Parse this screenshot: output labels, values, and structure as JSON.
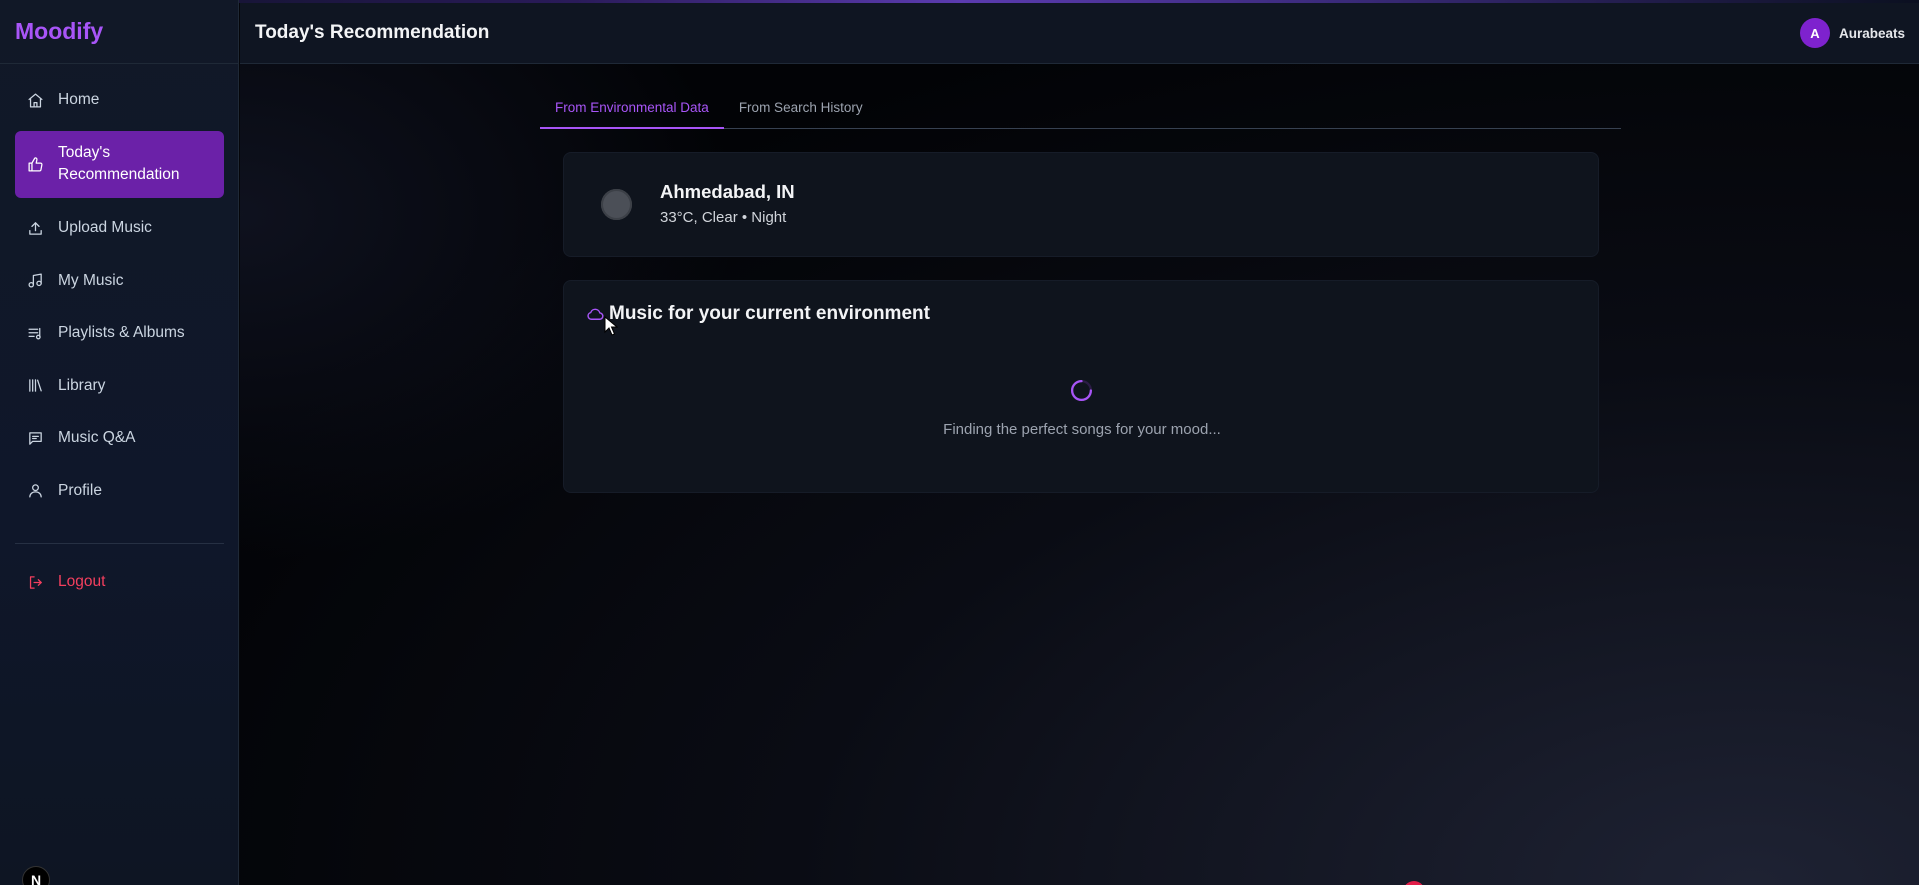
{
  "app": {
    "brand": "Moodify"
  },
  "sidebar": {
    "items": [
      {
        "label": "Home",
        "icon": "home-icon"
      },
      {
        "label": "Today's Recommendation",
        "icon": "thumbs-up-icon",
        "active": true
      },
      {
        "label": "Upload Music",
        "icon": "upload-icon"
      },
      {
        "label": "My Music",
        "icon": "music-note-icon"
      },
      {
        "label": "Playlists & Albums",
        "icon": "playlist-icon"
      },
      {
        "label": "Library",
        "icon": "library-icon"
      },
      {
        "label": "Music Q&A",
        "icon": "chat-icon"
      },
      {
        "label": "Profile",
        "icon": "user-icon"
      }
    ],
    "logout_label": "Logout"
  },
  "header": {
    "title": "Today's Recommendation",
    "user": {
      "initial": "A",
      "name": "Aurabeats"
    }
  },
  "tabs": [
    {
      "label": "From Environmental Data",
      "active": true
    },
    {
      "label": "From Search History",
      "active": false
    }
  ],
  "weather": {
    "city": "Ahmedabad, IN",
    "conditions": "33°C, Clear • Night"
  },
  "recommendation": {
    "title": "Music for your current environment",
    "loading_text": "Finding the perfect songs for your mood..."
  },
  "badge": {
    "letter": "N"
  },
  "colors": {
    "accent": "#a855f7",
    "active_nav_bg": "#6b21a8",
    "logout": "#f43f5e",
    "background": "#05060a"
  }
}
